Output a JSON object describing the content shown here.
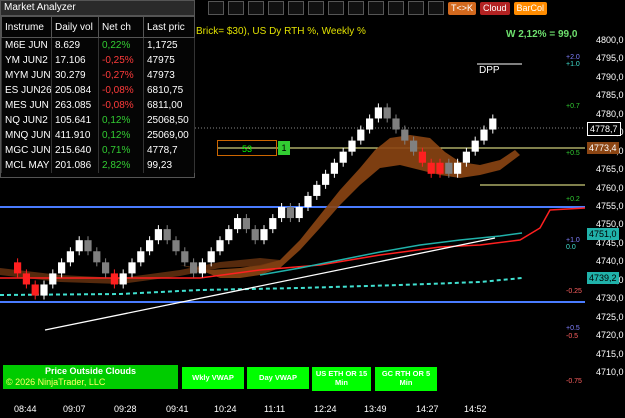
{
  "analyzer": {
    "title": "Market Analyzer",
    "headers": [
      "Instrume",
      "Daily vol",
      "Net ch",
      "Last pric"
    ],
    "rows": [
      {
        "instrument": "M6E JUN",
        "volume": "8.629",
        "net": "0,22%",
        "last": "1,1725",
        "dir": "pos"
      },
      {
        "instrument": "YM JUN2",
        "volume": "17.106",
        "net": "-0,25%",
        "last": "47975",
        "dir": "neg"
      },
      {
        "instrument": "MYM JUN",
        "volume": "30.279",
        "net": "-0,27%",
        "last": "47973",
        "dir": "neg"
      },
      {
        "instrument": "ES JUN26",
        "volume": "205.084",
        "net": "-0,08%",
        "last": "6810,75",
        "dir": "neg"
      },
      {
        "instrument": "MES JUN",
        "volume": "263.085",
        "net": "-0,08%",
        "last": "6811,00",
        "dir": "neg"
      },
      {
        "instrument": "NQ JUN2",
        "volume": "105.641",
        "net": "0,12%",
        "last": "25068,50",
        "dir": "pos"
      },
      {
        "instrument": "MNQ JUN",
        "volume": "411.910",
        "net": "0,12%",
        "last": "25069,00",
        "dir": "pos"
      },
      {
        "instrument": "MGC JUN",
        "volume": "215.640",
        "net": "0,71%",
        "last": "4778,7",
        "dir": "pos"
      },
      {
        "instrument": "MCL MAY",
        "volume": "201.086",
        "net": "2,82%",
        "last": "99,23",
        "dir": "pos"
      }
    ]
  },
  "toolbar": {
    "ck": "T<>K",
    "cloud": "Cloud",
    "barcol": "BarCol"
  },
  "chart_label": "Brick= $30), US Dy RTH %, Weekly %",
  "weekly_stat": "W 2,12% = 99,0",
  "dpp_label": "DPP",
  "box_count": "53",
  "box_one": "1",
  "price_axis": [
    "4800,0",
    "4795,0",
    "4790,0",
    "4785,0",
    "4780,0",
    "4775,0",
    "4770,0",
    "4765,0",
    "4760,0",
    "4755,0",
    "4750,0",
    "4745,0",
    "4740,0",
    "4735,0",
    "4730,0",
    "4725,0",
    "4720,0",
    "4715,0",
    "4710,0"
  ],
  "price_tags": {
    "last": "4778,7",
    "cloud": "4773,4",
    "vwap": "4751,0",
    "ema": "4739,2"
  },
  "pct_labels": [
    "+2.0",
    "+1.0",
    "+0.7",
    "+0.5",
    "+0.2",
    "+1.0",
    "0.0",
    "-0.25",
    "+0.5",
    "-0.5",
    "-0.75"
  ],
  "time_axis": [
    "08:44",
    "09:07",
    "09:28",
    "09:41",
    "10:24",
    "11:11",
    "12:24",
    "13:49",
    "14:27",
    "14:52"
  ],
  "bottom_buttons": {
    "price_outside": "Price Outside Clouds",
    "wkly_vwap": "Wkly VWAP",
    "day_vwap": "Day VWAP",
    "us_eth": "US ETH OR 15 Min",
    "gc_rth": "GC RTH OR 5 Min"
  },
  "copyright": "© 2026 NinjaTrader, LLC",
  "colors": {
    "up": "#ffffff",
    "down": "#808080",
    "red_brick": "#ff2020",
    "cloud": "#8b4513",
    "accent": "#00ff00"
  },
  "chart_data": {
    "type": "renko",
    "title": "",
    "ylim": [
      4710,
      4802
    ],
    "bricks": [
      {
        "t": 0,
        "o": 4740,
        "dir": -1
      },
      {
        "t": 1,
        "o": 4737,
        "dir": -1
      },
      {
        "t": 2,
        "o": 4734,
        "dir": -1
      },
      {
        "t": 3,
        "o": 4731,
        "dir": 1
      },
      {
        "t": 4,
        "o": 4734,
        "dir": 1
      },
      {
        "t": 5,
        "o": 4737,
        "dir": 1
      },
      {
        "t": 6,
        "o": 4740,
        "dir": 1
      },
      {
        "t": 7,
        "o": 4743,
        "dir": 1
      },
      {
        "t": 8,
        "o": 4746,
        "dir": -1
      },
      {
        "t": 9,
        "o": 4743,
        "dir": -1
      },
      {
        "t": 10,
        "o": 4740,
        "dir": -1
      },
      {
        "t": 11,
        "o": 4737,
        "dir": -1
      },
      {
        "t": 12,
        "o": 4734,
        "dir": 1
      },
      {
        "t": 13,
        "o": 4737,
        "dir": 1
      },
      {
        "t": 14,
        "o": 4740,
        "dir": 1
      },
      {
        "t": 15,
        "o": 4743,
        "dir": 1
      },
      {
        "t": 16,
        "o": 4746,
        "dir": 1
      },
      {
        "t": 17,
        "o": 4749,
        "dir": -1
      },
      {
        "t": 18,
        "o": 4746,
        "dir": -1
      },
      {
        "t": 19,
        "o": 4743,
        "dir": -1
      },
      {
        "t": 20,
        "o": 4740,
        "dir": -1
      },
      {
        "t": 21,
        "o": 4737,
        "dir": 1
      },
      {
        "t": 22,
        "o": 4740,
        "dir": 1
      },
      {
        "t": 23,
        "o": 4743,
        "dir": 1
      },
      {
        "t": 24,
        "o": 4746,
        "dir": 1
      },
      {
        "t": 25,
        "o": 4749,
        "dir": 1
      },
      {
        "t": 26,
        "o": 4752,
        "dir": -1
      },
      {
        "t": 27,
        "o": 4749,
        "dir": -1
      },
      {
        "t": 28,
        "o": 4746,
        "dir": 1
      },
      {
        "t": 29,
        "o": 4749,
        "dir": 1
      },
      {
        "t": 30,
        "o": 4752,
        "dir": 1
      },
      {
        "t": 31,
        "o": 4755,
        "dir": -1
      },
      {
        "t": 32,
        "o": 4752,
        "dir": 1
      },
      {
        "t": 33,
        "o": 4755,
        "dir": 1
      },
      {
        "t": 34,
        "o": 4758,
        "dir": 1
      },
      {
        "t": 35,
        "o": 4761,
        "dir": 1
      },
      {
        "t": 36,
        "o": 4764,
        "dir": 1
      },
      {
        "t": 37,
        "o": 4767,
        "dir": 1
      },
      {
        "t": 38,
        "o": 4770,
        "dir": 1
      },
      {
        "t": 39,
        "o": 4773,
        "dir": 1
      },
      {
        "t": 40,
        "o": 4776,
        "dir": 1
      },
      {
        "t": 41,
        "o": 4779,
        "dir": 1
      },
      {
        "t": 42,
        "o": 4782,
        "dir": -1
      },
      {
        "t": 43,
        "o": 4779,
        "dir": -1
      },
      {
        "t": 44,
        "o": 4776,
        "dir": -1
      },
      {
        "t": 45,
        "o": 4773,
        "dir": -1
      },
      {
        "t": 46,
        "o": 4770,
        "dir": -1
      },
      {
        "t": 47,
        "o": 4767,
        "dir": -1
      },
      {
        "t": 48,
        "o": 4764,
        "dir": 1
      },
      {
        "t": 49,
        "o": 4767,
        "dir": -1
      },
      {
        "t": 50,
        "o": 4764,
        "dir": 1
      },
      {
        "t": 51,
        "o": 4767,
        "dir": 1
      },
      {
        "t": 52,
        "o": 4770,
        "dir": 1
      },
      {
        "t": 53,
        "o": 4773,
        "dir": 1
      },
      {
        "t": 54,
        "o": 4776,
        "dir": 1
      }
    ]
  }
}
